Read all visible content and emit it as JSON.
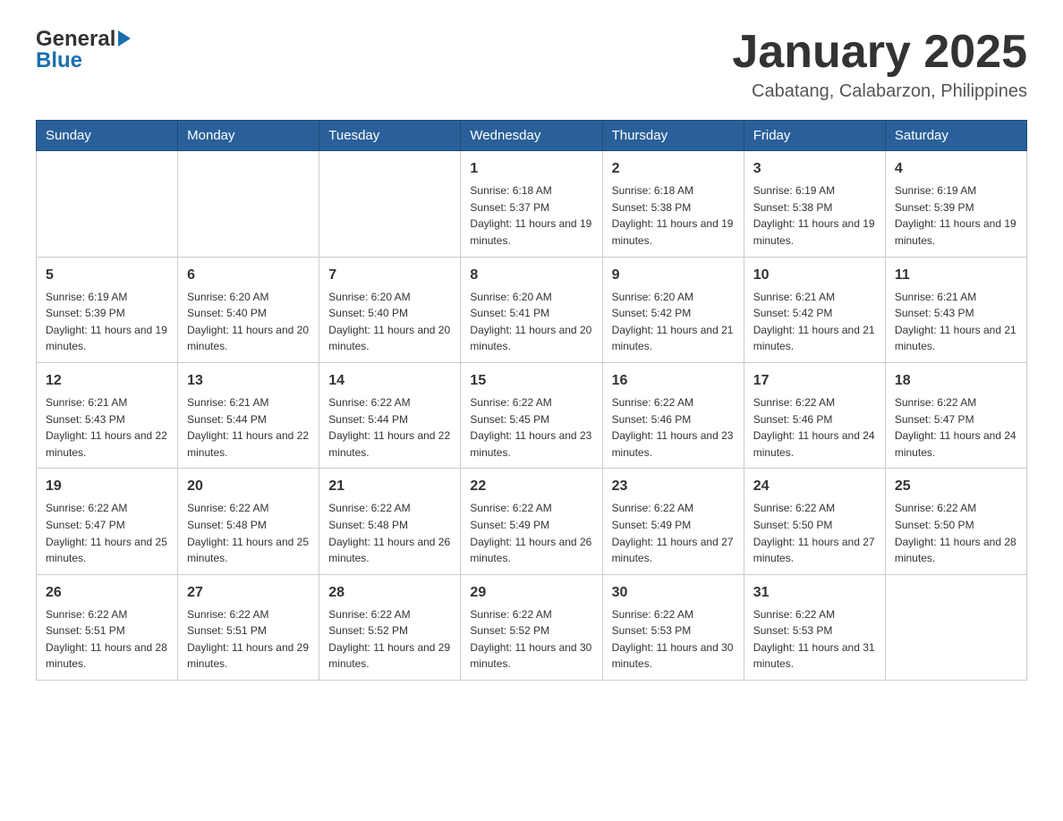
{
  "header": {
    "logo": {
      "general": "General",
      "blue": "Blue"
    },
    "title": "January 2025",
    "location": "Cabatang, Calabarzon, Philippines"
  },
  "days_of_week": [
    "Sunday",
    "Monday",
    "Tuesday",
    "Wednesday",
    "Thursday",
    "Friday",
    "Saturday"
  ],
  "weeks": [
    [
      {
        "day": "",
        "sunrise": "",
        "sunset": "",
        "daylight": ""
      },
      {
        "day": "",
        "sunrise": "",
        "sunset": "",
        "daylight": ""
      },
      {
        "day": "",
        "sunrise": "",
        "sunset": "",
        "daylight": ""
      },
      {
        "day": "1",
        "sunrise": "Sunrise: 6:18 AM",
        "sunset": "Sunset: 5:37 PM",
        "daylight": "Daylight: 11 hours and 19 minutes."
      },
      {
        "day": "2",
        "sunrise": "Sunrise: 6:18 AM",
        "sunset": "Sunset: 5:38 PM",
        "daylight": "Daylight: 11 hours and 19 minutes."
      },
      {
        "day": "3",
        "sunrise": "Sunrise: 6:19 AM",
        "sunset": "Sunset: 5:38 PM",
        "daylight": "Daylight: 11 hours and 19 minutes."
      },
      {
        "day": "4",
        "sunrise": "Sunrise: 6:19 AM",
        "sunset": "Sunset: 5:39 PM",
        "daylight": "Daylight: 11 hours and 19 minutes."
      }
    ],
    [
      {
        "day": "5",
        "sunrise": "Sunrise: 6:19 AM",
        "sunset": "Sunset: 5:39 PM",
        "daylight": "Daylight: 11 hours and 19 minutes."
      },
      {
        "day": "6",
        "sunrise": "Sunrise: 6:20 AM",
        "sunset": "Sunset: 5:40 PM",
        "daylight": "Daylight: 11 hours and 20 minutes."
      },
      {
        "day": "7",
        "sunrise": "Sunrise: 6:20 AM",
        "sunset": "Sunset: 5:40 PM",
        "daylight": "Daylight: 11 hours and 20 minutes."
      },
      {
        "day": "8",
        "sunrise": "Sunrise: 6:20 AM",
        "sunset": "Sunset: 5:41 PM",
        "daylight": "Daylight: 11 hours and 20 minutes."
      },
      {
        "day": "9",
        "sunrise": "Sunrise: 6:20 AM",
        "sunset": "Sunset: 5:42 PM",
        "daylight": "Daylight: 11 hours and 21 minutes."
      },
      {
        "day": "10",
        "sunrise": "Sunrise: 6:21 AM",
        "sunset": "Sunset: 5:42 PM",
        "daylight": "Daylight: 11 hours and 21 minutes."
      },
      {
        "day": "11",
        "sunrise": "Sunrise: 6:21 AM",
        "sunset": "Sunset: 5:43 PM",
        "daylight": "Daylight: 11 hours and 21 minutes."
      }
    ],
    [
      {
        "day": "12",
        "sunrise": "Sunrise: 6:21 AM",
        "sunset": "Sunset: 5:43 PM",
        "daylight": "Daylight: 11 hours and 22 minutes."
      },
      {
        "day": "13",
        "sunrise": "Sunrise: 6:21 AM",
        "sunset": "Sunset: 5:44 PM",
        "daylight": "Daylight: 11 hours and 22 minutes."
      },
      {
        "day": "14",
        "sunrise": "Sunrise: 6:22 AM",
        "sunset": "Sunset: 5:44 PM",
        "daylight": "Daylight: 11 hours and 22 minutes."
      },
      {
        "day": "15",
        "sunrise": "Sunrise: 6:22 AM",
        "sunset": "Sunset: 5:45 PM",
        "daylight": "Daylight: 11 hours and 23 minutes."
      },
      {
        "day": "16",
        "sunrise": "Sunrise: 6:22 AM",
        "sunset": "Sunset: 5:46 PM",
        "daylight": "Daylight: 11 hours and 23 minutes."
      },
      {
        "day": "17",
        "sunrise": "Sunrise: 6:22 AM",
        "sunset": "Sunset: 5:46 PM",
        "daylight": "Daylight: 11 hours and 24 minutes."
      },
      {
        "day": "18",
        "sunrise": "Sunrise: 6:22 AM",
        "sunset": "Sunset: 5:47 PM",
        "daylight": "Daylight: 11 hours and 24 minutes."
      }
    ],
    [
      {
        "day": "19",
        "sunrise": "Sunrise: 6:22 AM",
        "sunset": "Sunset: 5:47 PM",
        "daylight": "Daylight: 11 hours and 25 minutes."
      },
      {
        "day": "20",
        "sunrise": "Sunrise: 6:22 AM",
        "sunset": "Sunset: 5:48 PM",
        "daylight": "Daylight: 11 hours and 25 minutes."
      },
      {
        "day": "21",
        "sunrise": "Sunrise: 6:22 AM",
        "sunset": "Sunset: 5:48 PM",
        "daylight": "Daylight: 11 hours and 26 minutes."
      },
      {
        "day": "22",
        "sunrise": "Sunrise: 6:22 AM",
        "sunset": "Sunset: 5:49 PM",
        "daylight": "Daylight: 11 hours and 26 minutes."
      },
      {
        "day": "23",
        "sunrise": "Sunrise: 6:22 AM",
        "sunset": "Sunset: 5:49 PM",
        "daylight": "Daylight: 11 hours and 27 minutes."
      },
      {
        "day": "24",
        "sunrise": "Sunrise: 6:22 AM",
        "sunset": "Sunset: 5:50 PM",
        "daylight": "Daylight: 11 hours and 27 minutes."
      },
      {
        "day": "25",
        "sunrise": "Sunrise: 6:22 AM",
        "sunset": "Sunset: 5:50 PM",
        "daylight": "Daylight: 11 hours and 28 minutes."
      }
    ],
    [
      {
        "day": "26",
        "sunrise": "Sunrise: 6:22 AM",
        "sunset": "Sunset: 5:51 PM",
        "daylight": "Daylight: 11 hours and 28 minutes."
      },
      {
        "day": "27",
        "sunrise": "Sunrise: 6:22 AM",
        "sunset": "Sunset: 5:51 PM",
        "daylight": "Daylight: 11 hours and 29 minutes."
      },
      {
        "day": "28",
        "sunrise": "Sunrise: 6:22 AM",
        "sunset": "Sunset: 5:52 PM",
        "daylight": "Daylight: 11 hours and 29 minutes."
      },
      {
        "day": "29",
        "sunrise": "Sunrise: 6:22 AM",
        "sunset": "Sunset: 5:52 PM",
        "daylight": "Daylight: 11 hours and 30 minutes."
      },
      {
        "day": "30",
        "sunrise": "Sunrise: 6:22 AM",
        "sunset": "Sunset: 5:53 PM",
        "daylight": "Daylight: 11 hours and 30 minutes."
      },
      {
        "day": "31",
        "sunrise": "Sunrise: 6:22 AM",
        "sunset": "Sunset: 5:53 PM",
        "daylight": "Daylight: 11 hours and 31 minutes."
      },
      {
        "day": "",
        "sunrise": "",
        "sunset": "",
        "daylight": ""
      }
    ]
  ]
}
